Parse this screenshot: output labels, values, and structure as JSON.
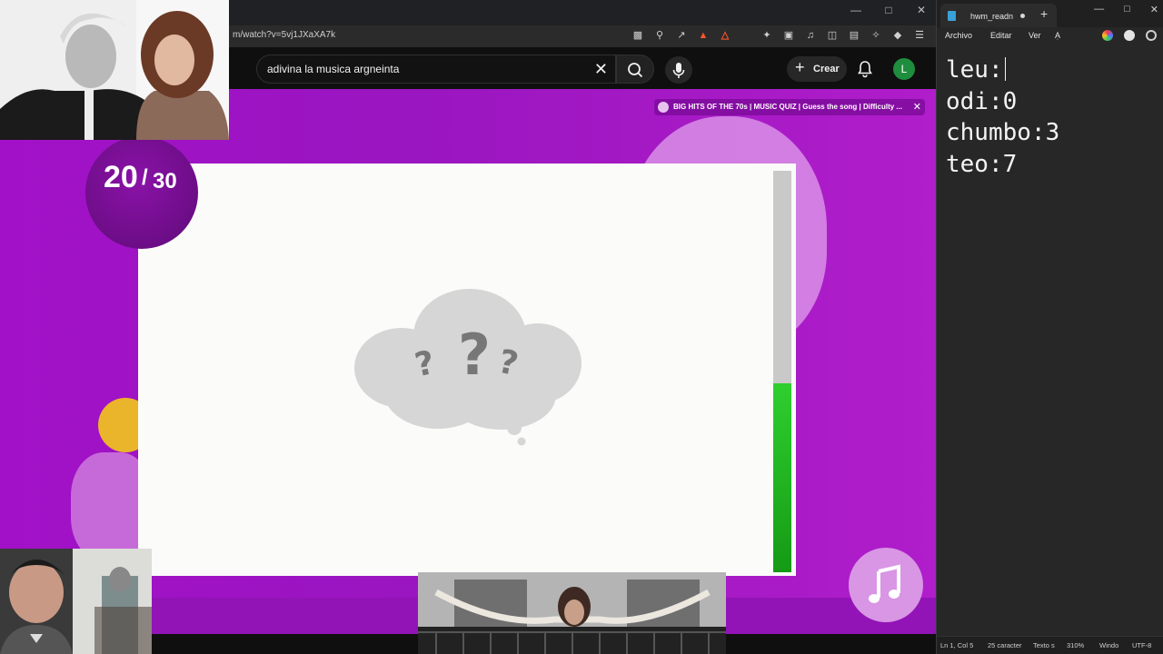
{
  "browser": {
    "url": "m/watch?v=5vj1JXaXA7k",
    "search": {
      "query": "adivina la musica argneinta"
    },
    "header": {
      "create_label": "Crear",
      "avatar_letter": "L"
    }
  },
  "video": {
    "playlist_title": "BIG HITS OF THE 70s | MUSIC QUIZ | Guess the song | Difficulty ...",
    "question": {
      "current": "20",
      "separator": "/",
      "total": "30"
    },
    "timer_remaining": 0.47,
    "colors": {
      "background": "#a211c8",
      "timer_fill": "#1fb81f",
      "accent_yellow": "#eab52b"
    }
  },
  "notepad": {
    "tab_title": "hwm_readn",
    "menu": {
      "file": "Archivo",
      "edit": "Editar",
      "view": "Ver"
    },
    "lines": [
      "leu:",
      "odi:0",
      "chumbo:3",
      "teo:7"
    ],
    "status": {
      "position": "Ln 1, Col 5",
      "chars": "25 caracter",
      "format": "Texto s",
      "zoom": "310%",
      "line_ending": "Windo",
      "encoding": "UTF-8"
    }
  }
}
